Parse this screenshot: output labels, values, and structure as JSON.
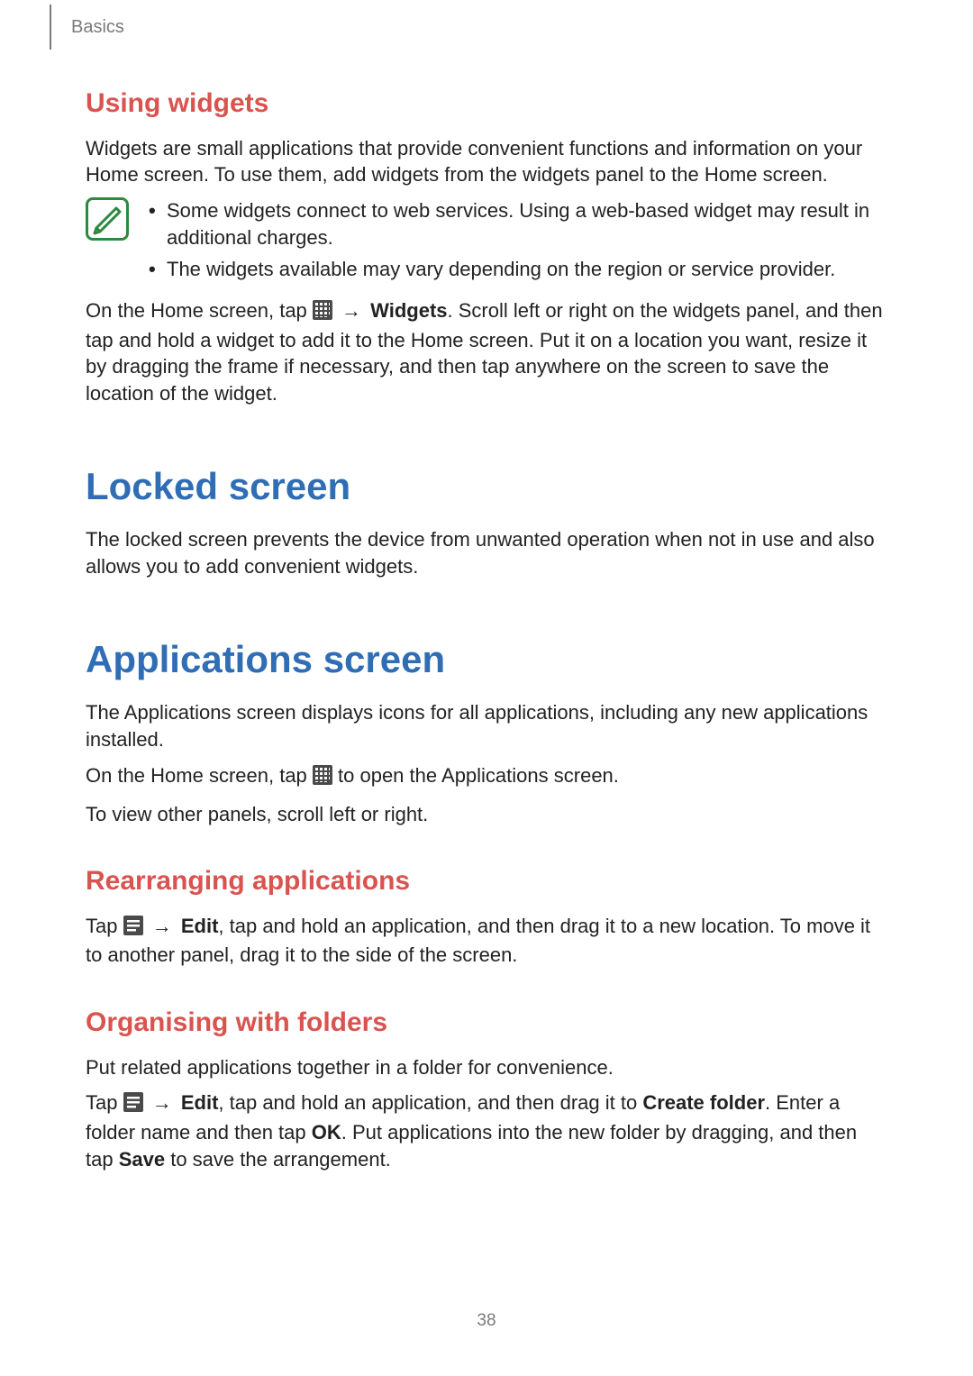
{
  "header": {
    "section": "Basics"
  },
  "page_number": "38",
  "arrow": "→",
  "sections": {
    "using_widgets": {
      "title": "Using widgets",
      "intro": "Widgets are small applications that provide convenient functions and information on your Home screen. To use them, add widgets from the widgets panel to the Home screen.",
      "notes": [
        "Some widgets connect to web services. Using a web-based widget may result in additional charges.",
        "The widgets available may vary depending on the region or service provider."
      ],
      "para_pre": "On the Home screen, tap ",
      "widgets_bold": "Widgets",
      "para_post": ". Scroll left or right on the widgets panel, and then tap and hold a widget to add it to the Home screen. Put it on a location you want, resize it by dragging the frame if necessary, and then tap anywhere on the screen to save the location of the widget."
    },
    "locked_screen": {
      "title": "Locked screen",
      "body": "The locked screen prevents the device from unwanted operation when not in use and also allows you to add convenient widgets."
    },
    "apps_screen": {
      "title": "Applications screen",
      "p1": "The Applications screen displays icons for all applications, including any new applications installed.",
      "p2_pre": "On the Home screen, tap ",
      "p2_post": " to open the Applications screen.",
      "p3": "To view other panels, scroll left or right."
    },
    "rearranging": {
      "title": "Rearranging applications",
      "pre": "Tap ",
      "edit_bold": "Edit",
      "post": ", tap and hold an application, and then drag it to a new location. To move it to another panel, drag it to the side of the screen."
    },
    "folders": {
      "title": "Organising with folders",
      "intro": "Put related applications together in a folder for convenience.",
      "pre": "Tap ",
      "edit_bold": "Edit",
      "mid1": ", tap and hold an application, and then drag it to ",
      "create_folder_bold": "Create folder",
      "mid2": ". Enter a folder name and then tap ",
      "ok_bold": "OK",
      "mid3": ". Put applications into the new folder by dragging, and then tap ",
      "save_bold": "Save",
      "end": " to save the arrangement."
    }
  }
}
